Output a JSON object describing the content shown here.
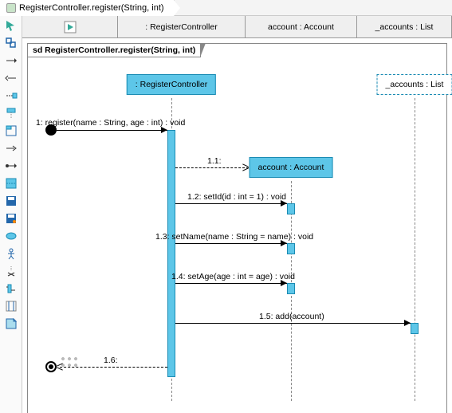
{
  "tab": {
    "title": "RegisterController.register(String, int)"
  },
  "header": {
    "play_label": "",
    "controller": ": RegisterController",
    "account": "account : Account",
    "accounts": "_accounts : List"
  },
  "frame": {
    "label": "sd RegisterController.register(String, int)"
  },
  "lifelines": {
    "controller": ": RegisterController",
    "account": "account : Account",
    "accounts": "_accounts : List"
  },
  "messages": {
    "m1": "1: register(name : String, age : int) : void",
    "m11": "1.1:",
    "m12": "1.2: setId(id : int = 1) : void",
    "m13": "1.3: setName(name : String = name) : void",
    "m14": "1.4: setAge(age : int = age) : void",
    "m15": "1.5: add(account)",
    "m16": "1.6:"
  },
  "chart_data": {
    "type": "sequence-diagram",
    "title": "RegisterController.register(String, int)",
    "lifelines": [
      {
        "id": "controller",
        "label": ": RegisterController"
      },
      {
        "id": "account",
        "label": "account : Account",
        "created_by": "1.1"
      },
      {
        "id": "accounts",
        "label": "_accounts : List"
      }
    ],
    "messages": [
      {
        "seq": "1",
        "from": "start",
        "to": "controller",
        "label": "register(name : String, age : int) : void",
        "kind": "sync"
      },
      {
        "seq": "1.1",
        "from": "controller",
        "to": "account",
        "label": "",
        "kind": "create"
      },
      {
        "seq": "1.2",
        "from": "controller",
        "to": "account",
        "label": "setId(id : int = 1) : void",
        "kind": "sync"
      },
      {
        "seq": "1.3",
        "from": "controller",
        "to": "account",
        "label": "setName(name : String = name) : void",
        "kind": "sync"
      },
      {
        "seq": "1.4",
        "from": "controller",
        "to": "account",
        "label": "setAge(age : int = age) : void",
        "kind": "sync"
      },
      {
        "seq": "1.5",
        "from": "controller",
        "to": "accounts",
        "label": "add(account)",
        "kind": "sync"
      },
      {
        "seq": "1.6",
        "from": "controller",
        "to": "end",
        "label": "",
        "kind": "return"
      }
    ]
  }
}
